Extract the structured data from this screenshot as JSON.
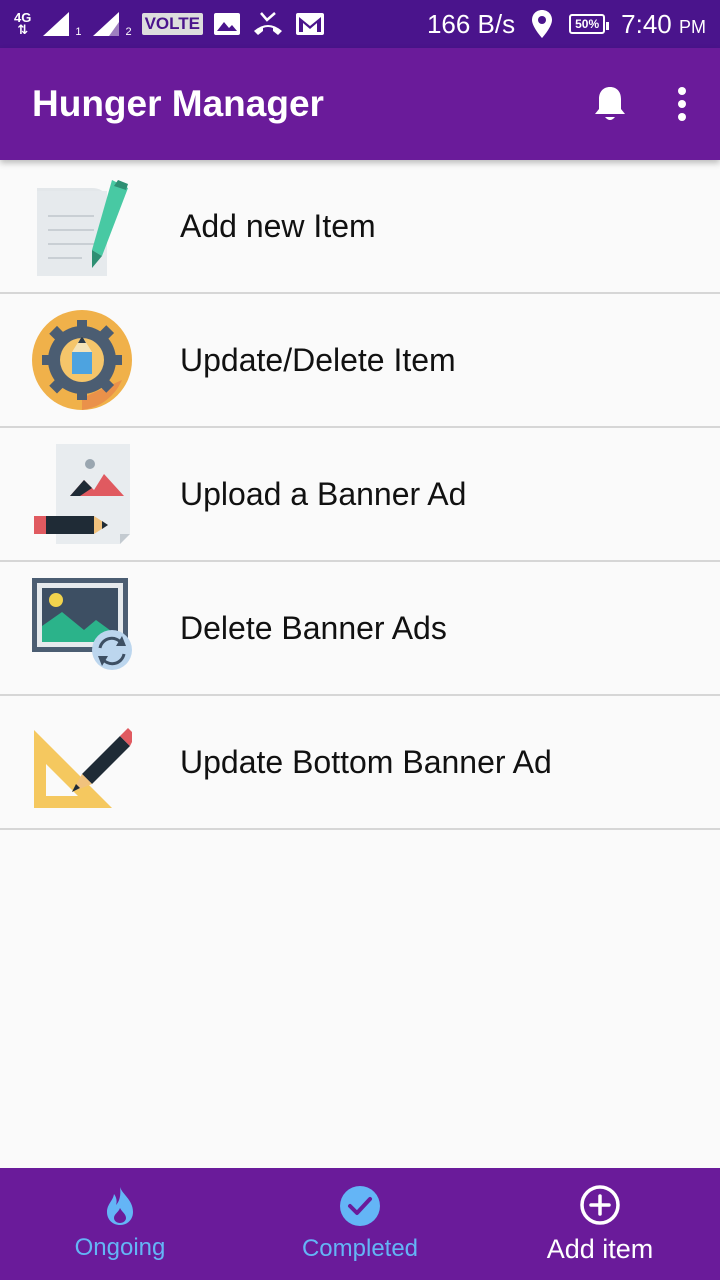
{
  "status_bar": {
    "network_type": "4G",
    "sim1": "1",
    "sim2": "2",
    "volte": "VOLTE",
    "data_speed": "166 B/s",
    "battery": "50%",
    "time": "7:40",
    "ampm": "PM"
  },
  "app_bar": {
    "title": "Hunger Manager",
    "actions": [
      "bell-icon",
      "more-vert-icon"
    ]
  },
  "menu": {
    "items": [
      {
        "label": "Add new Item",
        "icon": "document-pen-icon"
      },
      {
        "label": "Update/Delete Item",
        "icon": "gear-pencil-icon"
      },
      {
        "label": "Upload a Banner Ad",
        "icon": "image-pencil-icon"
      },
      {
        "label": "Delete Banner Ads",
        "icon": "image-refresh-icon"
      },
      {
        "label": "Update Bottom Banner Ad",
        "icon": "ruler-pencil-icon"
      }
    ]
  },
  "bottom_nav": {
    "tabs": [
      {
        "label": "Ongoing",
        "icon": "flame-icon",
        "active": false
      },
      {
        "label": "Completed",
        "icon": "check-circle-icon",
        "active": false
      },
      {
        "label": "Add item",
        "icon": "add-circle-icon",
        "active": true
      }
    ]
  },
  "colors": {
    "status_bar": "#4a148c",
    "primary": "#6a1b9a",
    "nav_inactive": "#64b5f6",
    "nav_active": "#ffffff"
  }
}
